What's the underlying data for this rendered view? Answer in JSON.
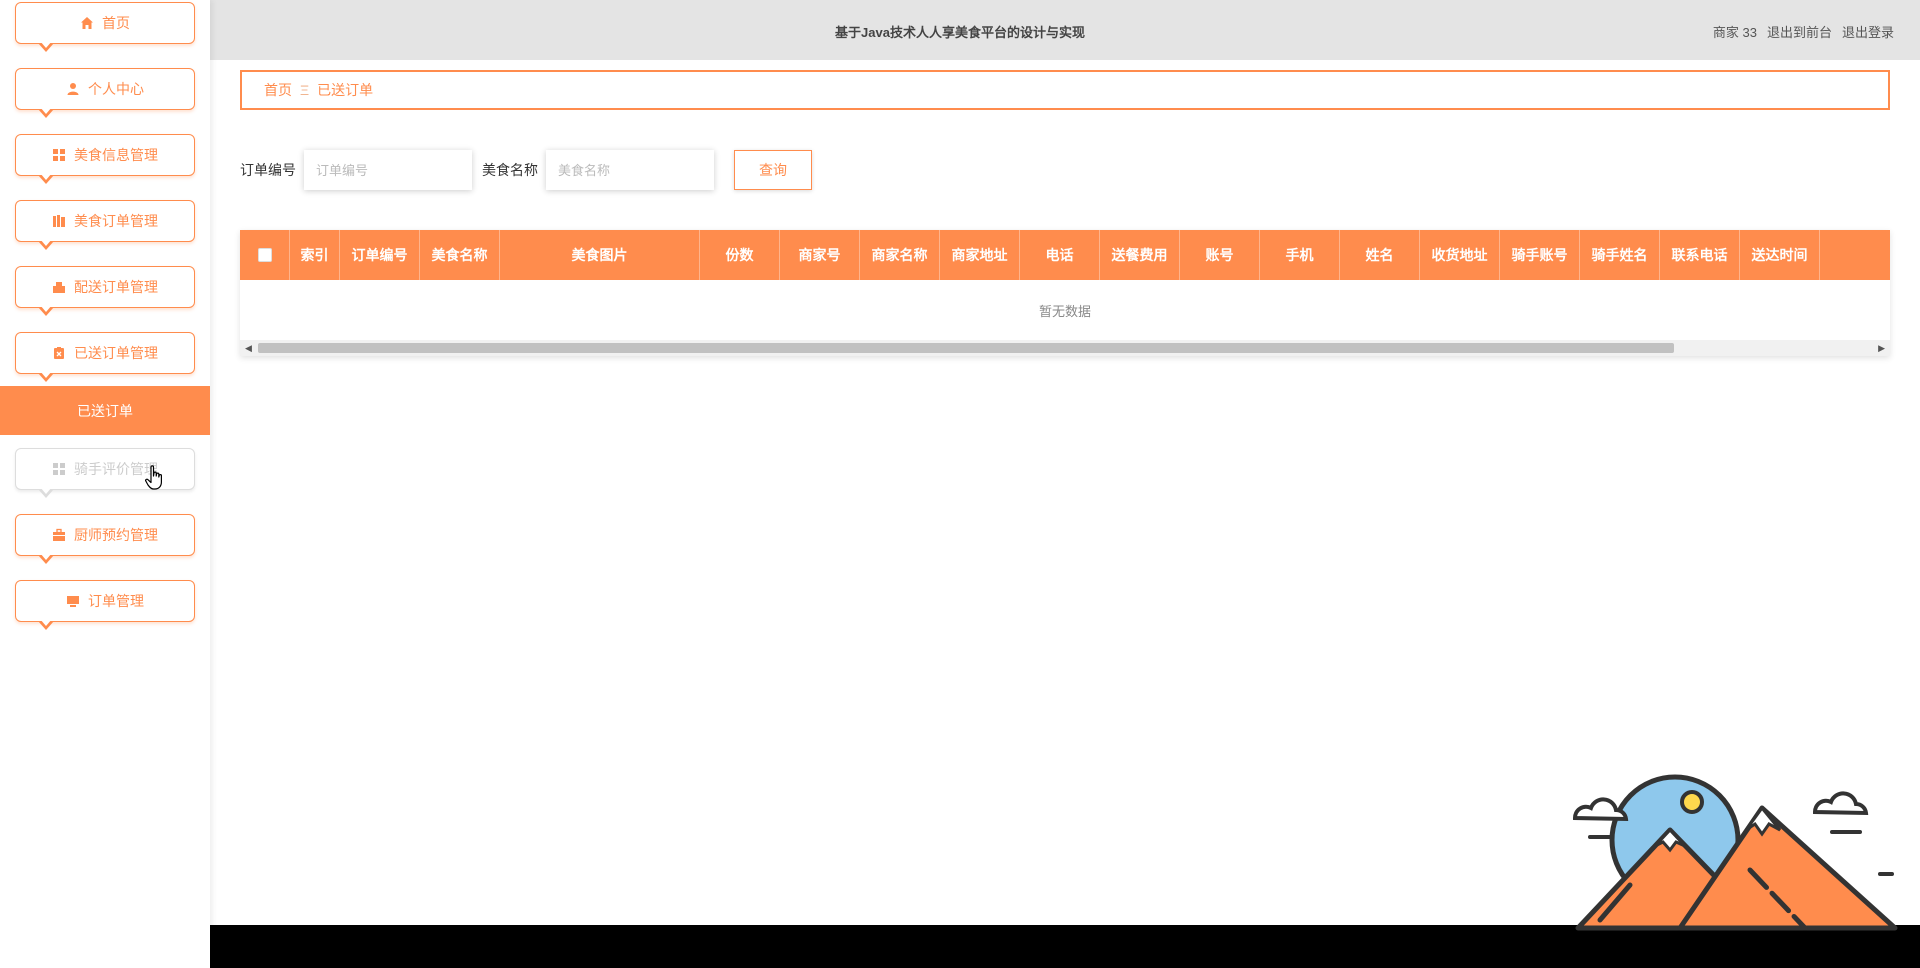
{
  "header": {
    "title": "基于Java技术人人享美食平台的设计与实现",
    "user": "商家 33",
    "back_to_front": "退出到前台",
    "logout": "退出登录"
  },
  "sidebar": {
    "items": [
      {
        "label": "首页",
        "icon": "home-icon"
      },
      {
        "label": "个人中心",
        "icon": "user-icon"
      },
      {
        "label": "美食信息管理",
        "icon": "grid-icon"
      },
      {
        "label": "美食订单管理",
        "icon": "book-icon"
      },
      {
        "label": "配送订单管理",
        "icon": "delivery-icon"
      },
      {
        "label": "已送订单管理",
        "icon": "clipboard-icon"
      },
      {
        "label": "骑手评价管理",
        "icon": "grid-icon"
      },
      {
        "label": "厨师预约管理",
        "icon": "briefcase-icon"
      },
      {
        "label": "订单管理",
        "icon": "monitor-icon"
      }
    ],
    "active_sub": "已送订单"
  },
  "breadcrumb": {
    "home": "首页",
    "separator": "Ξ",
    "current": "已送订单"
  },
  "search": {
    "order_no_label": "订单编号",
    "order_no_placeholder": "订单编号",
    "food_name_label": "美食名称",
    "food_name_placeholder": "美食名称",
    "query_button": "查询"
  },
  "table": {
    "columns": [
      "索引",
      "订单编号",
      "美食名称",
      "美食图片",
      "份数",
      "商家号",
      "商家名称",
      "商家地址",
      "电话",
      "送餐费用",
      "账号",
      "手机",
      "姓名",
      "收货地址",
      "骑手账号",
      "骑手姓名",
      "联系电话",
      "送达时间"
    ],
    "empty_text": "暂无数据"
  },
  "colors": {
    "accent": "#ff8c4d",
    "header_bg": "#e4e4e4",
    "footer_bg": "#000000"
  }
}
